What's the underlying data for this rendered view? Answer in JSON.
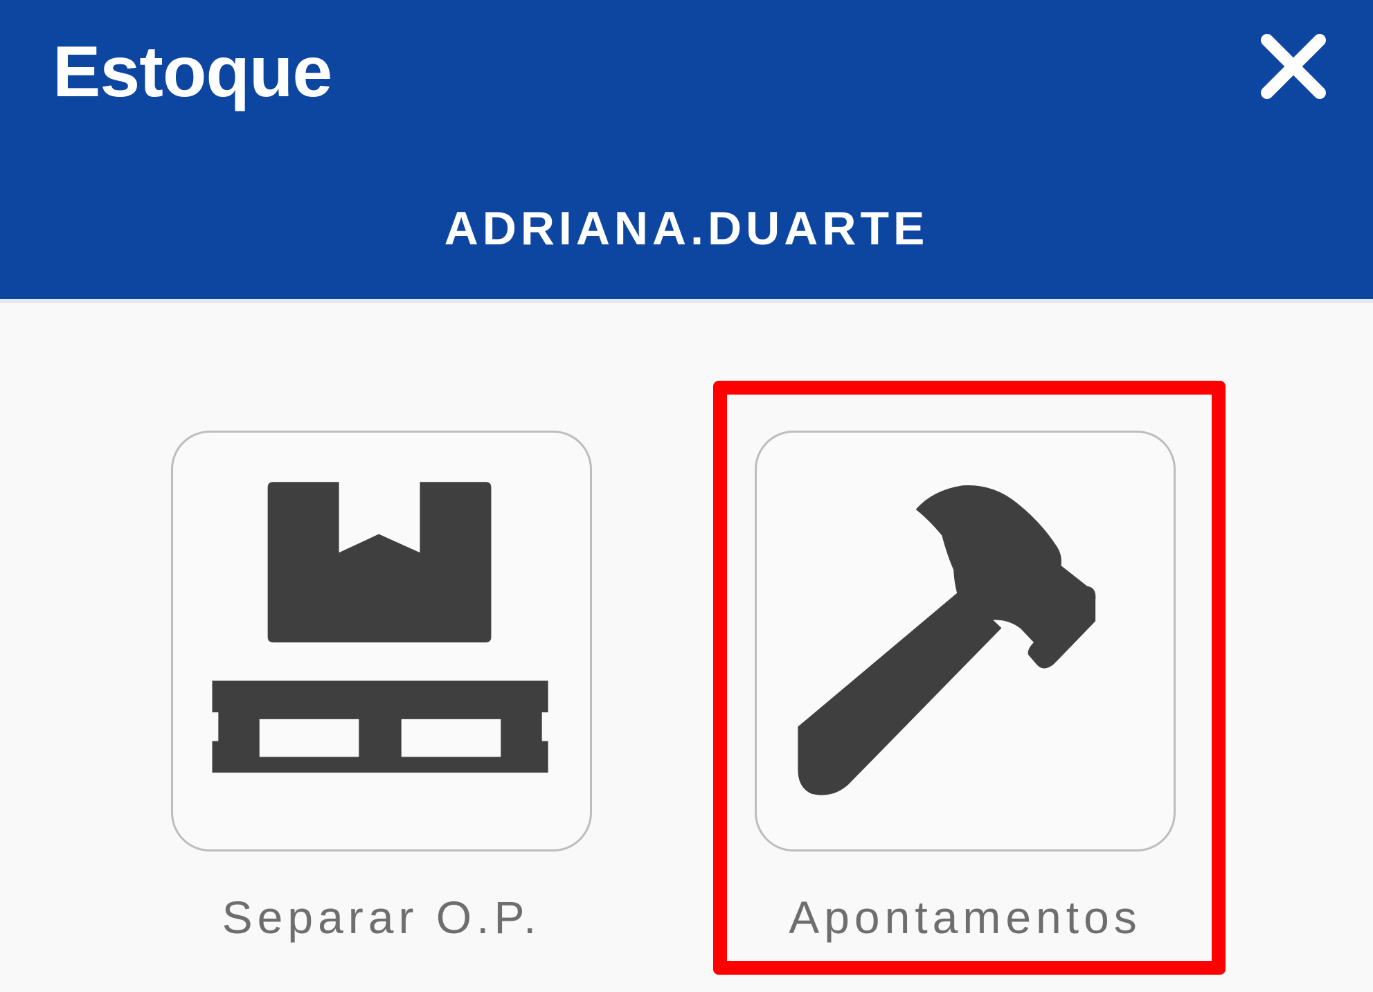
{
  "header": {
    "title": "Estoque",
    "username": "ADRIANA.DUARTE",
    "close_icon": "close-icon",
    "background_color": "#0d46a0"
  },
  "menu": {
    "items": [
      {
        "label": "Separar O.P.",
        "icon": "pallet-icon"
      },
      {
        "label": "Apontamentos",
        "icon": "hammer-icon",
        "highlighted": true
      }
    ]
  },
  "colors": {
    "icon": "#3f3f3f",
    "highlight": "#ff0000"
  }
}
